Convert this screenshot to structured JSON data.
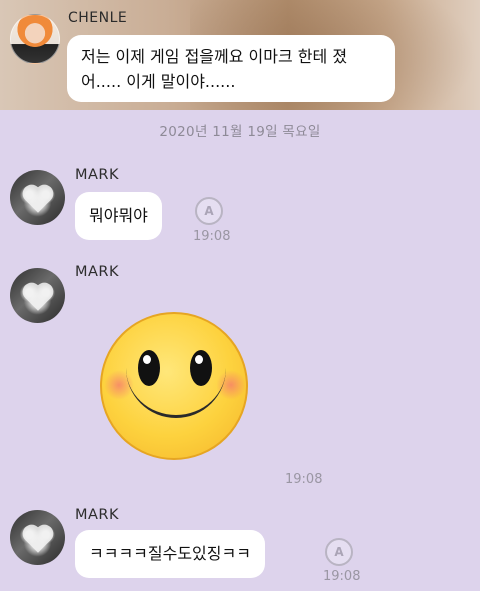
{
  "pinned_message": {
    "sender": "CHENLE",
    "line1": "저는 이제 게임 접을께요 이마크 한테 졌",
    "line2": "어..... 이게 말이야......"
  },
  "date_divider": "2020년 11월 19일 목요일",
  "messages": [
    {
      "sender": "MARK",
      "text": "뭐야뭐야",
      "time": "19:08",
      "reaction_icon": "reaction-add-icon"
    },
    {
      "sender": "MARK",
      "emoticon": "smiling-face-emoticon",
      "time": "19:08"
    },
    {
      "sender": "MARK",
      "text": "ㅋㅋㅋㅋ질수도있징ㅋㅋ",
      "time": "19:08",
      "reaction_icon": "reaction-add-icon"
    }
  ],
  "colors": {
    "chat_background": "#ddd3ec",
    "bubble": "#ffffff",
    "meta_text": "#9a96a3"
  }
}
